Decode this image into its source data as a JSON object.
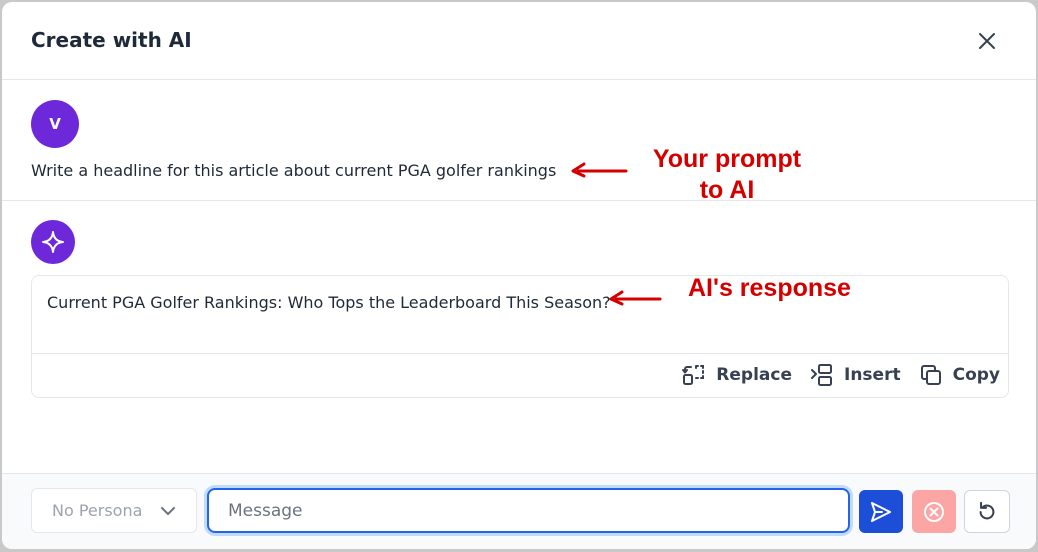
{
  "dialog": {
    "title": "Create with AI",
    "close_icon": "close-icon"
  },
  "user_message": {
    "avatar_initial": "V",
    "prompt": "Write a headline for this article about current PGA golfer rankings"
  },
  "ai_message": {
    "avatar_icon": "sparkle-icon",
    "response": "Current PGA Golfer Rankings: Who Tops the Leaderboard This Season?",
    "actions": {
      "replace": "Replace",
      "insert": "Insert",
      "copy": "Copy"
    }
  },
  "annotations": {
    "prompt_line1": "Your prompt",
    "prompt_line2": "to AI",
    "response": "AI's response",
    "color": "#d40000"
  },
  "footer": {
    "persona_value": "No Persona",
    "message_placeholder": "Message",
    "send_icon": "send-icon",
    "stop_icon": "stop-icon",
    "reset_icon": "reset-icon"
  },
  "colors": {
    "accent_purple": "#6d28d9",
    "primary_blue": "#1d4ed8",
    "stop_red_disabled": "#fca5a5"
  }
}
